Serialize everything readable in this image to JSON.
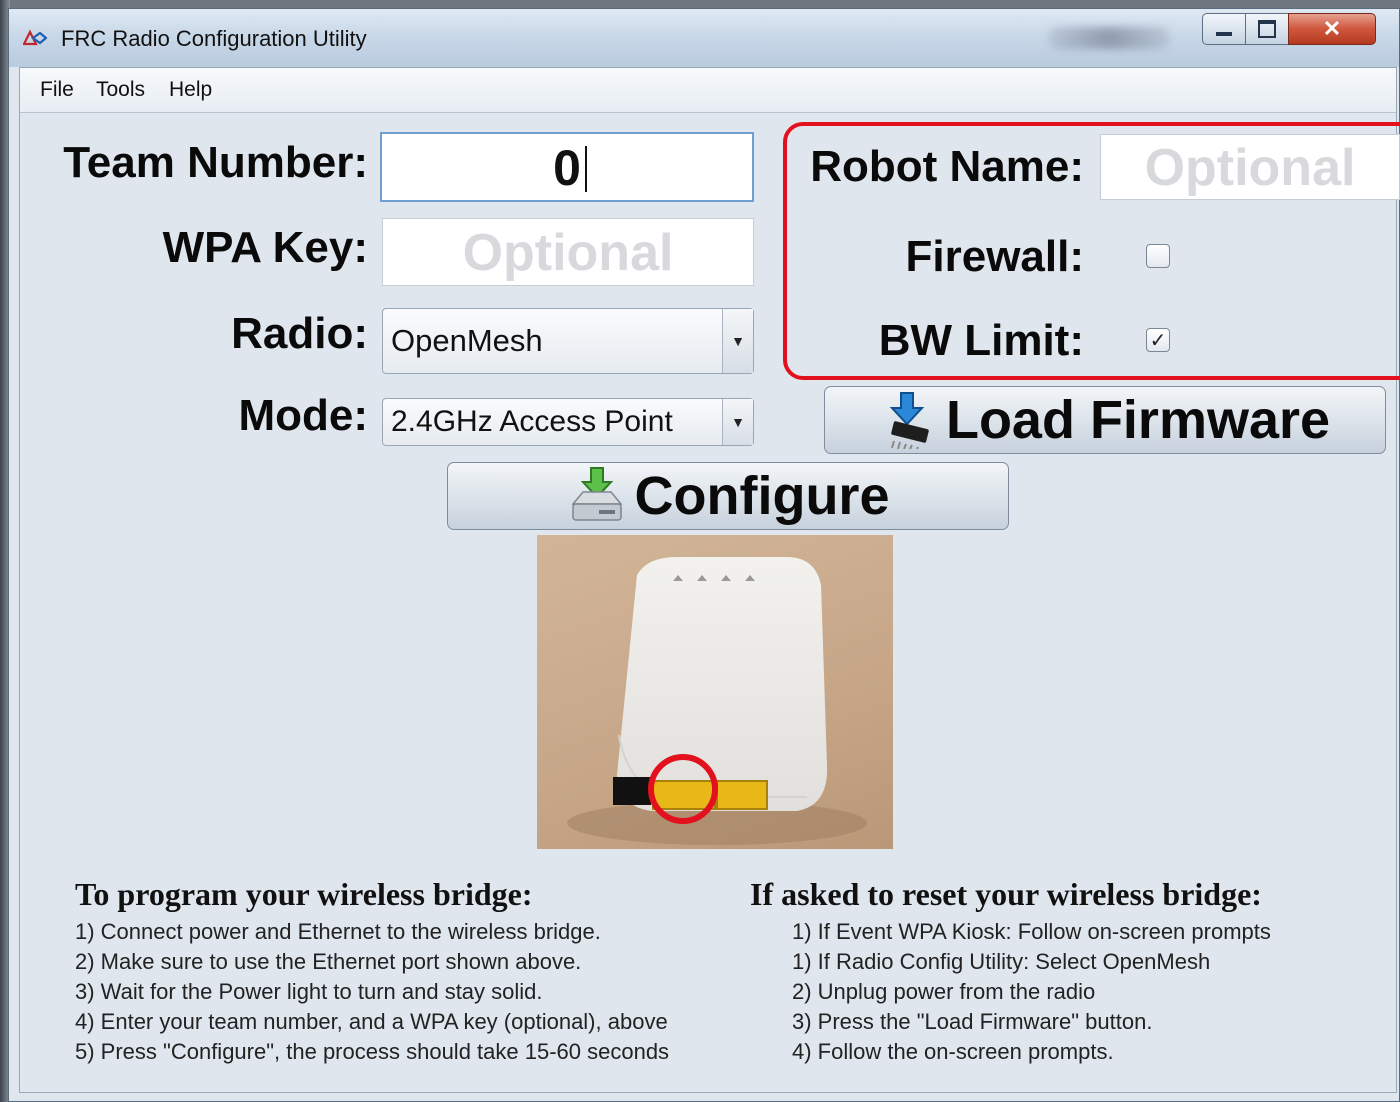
{
  "window": {
    "title": "FRC Radio Configuration Utility"
  },
  "menu": [
    "File",
    "Tools",
    "Help"
  ],
  "form": {
    "team_number_label": "Team Number:",
    "team_number_value": "0",
    "wpa_key_label": "WPA Key:",
    "wpa_key_placeholder": "Optional",
    "radio_label": "Radio:",
    "radio_value": "OpenMesh",
    "mode_label": "Mode:",
    "mode_value": "2.4GHz Access Point",
    "robot_name_label": "Robot Name:",
    "robot_name_placeholder": "Optional",
    "firewall_label": "Firewall:",
    "firewall_checked": false,
    "bw_limit_label": "BW Limit:",
    "bw_limit_checked": true
  },
  "buttons": {
    "load_firmware": "Load Firmware",
    "configure": "Configure"
  },
  "instructions": {
    "program": {
      "heading": "To program your wireless bridge:",
      "steps": [
        "1) Connect power and Ethernet to the wireless bridge.",
        "2) Make sure to use the Ethernet port shown above.",
        "3) Wait for the Power light to turn and stay solid.",
        "4) Enter your team number, and a WPA key (optional), above",
        "5) Press \"Configure\", the process should take 15-60 seconds"
      ]
    },
    "reset": {
      "heading": "If asked to reset your wireless bridge:",
      "steps": [
        "1) If Event WPA Kiosk: Follow on-screen prompts",
        "1) If Radio Config Utility: Select OpenMesh",
        "2) Unplug power from the radio",
        "3) Press the \"Load Firmware\" button.",
        "4) Follow the on-screen prompts."
      ]
    }
  },
  "colors": {
    "highlight": "#e3101e",
    "port": "#e8b818"
  },
  "icons": {
    "app": "frc-logo-icon",
    "load_firmware": "chip-download-icon",
    "configure": "drive-download-icon"
  }
}
